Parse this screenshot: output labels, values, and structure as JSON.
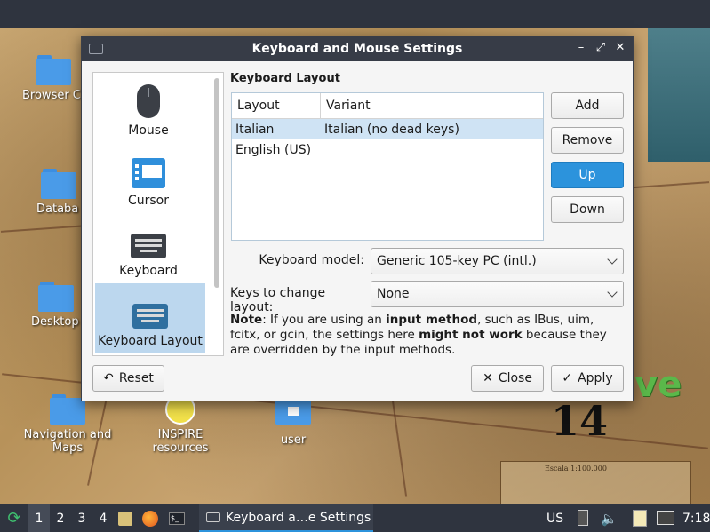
{
  "desktop": {
    "icons": [
      {
        "label": "Browser C"
      },
      {
        "label": "Databa"
      },
      {
        "label": "Desktop"
      },
      {
        "label": "Navigation and Maps"
      },
      {
        "label": "INSPIRE resources"
      },
      {
        "label": "user"
      }
    ],
    "wallpaper_number": "14",
    "wallpaper_green_text": "ve",
    "wallpaper_scale_text": "Escala 1:100.000"
  },
  "dialog": {
    "title": "Keyboard and Mouse Settings",
    "window_buttons": [
      "minimize-icon",
      "maximize-icon",
      "close-icon"
    ],
    "sidebar": {
      "items": [
        {
          "label": "Mouse",
          "icon": "mouse-icon",
          "selected": false
        },
        {
          "label": "Cursor",
          "icon": "cursor-icon",
          "selected": false
        },
        {
          "label": "Keyboard",
          "icon": "keyboard-icon",
          "selected": false
        },
        {
          "label": "Keyboard Layout",
          "icon": "keyboard-layout-icon",
          "selected": true
        }
      ]
    },
    "section_title": "Keyboard Layout",
    "table": {
      "headers": [
        "Layout",
        "Variant"
      ],
      "rows": [
        {
          "layout": "Italian",
          "variant": "Italian (no dead keys)",
          "selected": true
        },
        {
          "layout": "English (US)",
          "variant": "",
          "selected": false
        }
      ]
    },
    "buttons": {
      "add": "Add",
      "remove": "Remove",
      "up": "Up",
      "down": "Down",
      "reset": "Reset",
      "close": "Close",
      "apply": "Apply"
    },
    "keyboard_model": {
      "label": "Keyboard model:",
      "value": "Generic 105-key PC (intl.)"
    },
    "change_layout": {
      "label": "Keys to change layout:",
      "value": "None"
    },
    "note": {
      "p1": "Note",
      "p2": ": If you are using an ",
      "p3": "input method",
      "p4": ", such as IBus, uim, fcitx, or gcin, the settings here ",
      "p5": "might not work",
      "p6": " because they are overridden by the input methods."
    },
    "accent_color": "#2c93dc"
  },
  "taskbar": {
    "workspaces": [
      "1",
      "2",
      "3",
      "4"
    ],
    "active_workspace": "1",
    "task_label": "Keyboard a…e Settings",
    "keyboard_indicator": "US",
    "clock": "7:18"
  }
}
